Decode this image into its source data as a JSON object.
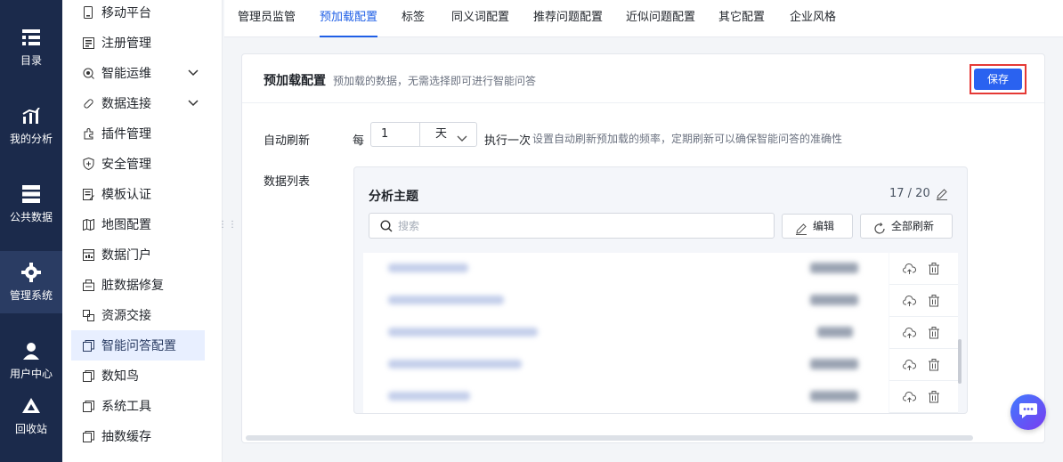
{
  "rail": {
    "items": [
      {
        "label": "目录",
        "icon": "list-icon"
      },
      {
        "label": "我的分析",
        "icon": "chart-icon"
      },
      {
        "label": "公共数据",
        "icon": "database-icon"
      },
      {
        "label": "管理系统",
        "icon": "gear-icon",
        "active": true
      },
      {
        "label": "用户中心",
        "icon": "user-icon"
      },
      {
        "label": "回收站",
        "icon": "recycle-icon"
      }
    ]
  },
  "submenu": {
    "items": [
      {
        "label": "移动平台",
        "icon": "mobile-icon"
      },
      {
        "label": "注册管理",
        "icon": "register-icon"
      },
      {
        "label": "智能运维",
        "icon": "ops-icon",
        "expandable": true
      },
      {
        "label": "数据连接",
        "icon": "link-icon",
        "expandable": true
      },
      {
        "label": "插件管理",
        "icon": "plugin-icon"
      },
      {
        "label": "安全管理",
        "icon": "shield-icon"
      },
      {
        "label": "模板认证",
        "icon": "template-icon"
      },
      {
        "label": "地图配置",
        "icon": "map-icon"
      },
      {
        "label": "数据门户",
        "icon": "portal-icon"
      },
      {
        "label": "脏数据修复",
        "icon": "repair-icon"
      },
      {
        "label": "资源交接",
        "icon": "handover-icon"
      },
      {
        "label": "智能问答配置",
        "icon": "copy-icon",
        "active": true
      },
      {
        "label": "数知鸟",
        "icon": "copy-icon"
      },
      {
        "label": "系统工具",
        "icon": "copy-icon"
      },
      {
        "label": "抽数缓存",
        "icon": "copy-icon"
      }
    ]
  },
  "tabs": [
    {
      "label": "管理员监管"
    },
    {
      "label": "预加载配置",
      "active": true
    },
    {
      "label": "标签"
    },
    {
      "label": "同义词配置"
    },
    {
      "label": "推荐问题配置"
    },
    {
      "label": "近似问题配置"
    },
    {
      "label": "其它配置"
    },
    {
      "label": "企业风格"
    }
  ],
  "card": {
    "title": "预加载配置",
    "description": "预加载的数据，无需选择即可进行智能问答",
    "save_label": "保存"
  },
  "refresh": {
    "label": "自动刷新",
    "every": "每",
    "value": "1",
    "unit": "天",
    "exec": "执行一次",
    "description": "设置自动刷新预加载的频率，定期刷新可以确保智能问答的准确性"
  },
  "datalist": {
    "label": "数据列表",
    "panel_title": "分析主题",
    "count": "17 / 20",
    "search_placeholder": "搜索",
    "edit_label": "编辑",
    "refresh_all_label": "全部刷新"
  },
  "colors": {
    "rail_bg": "#1b2a4b",
    "accent": "#1f5fe6",
    "save_bg": "#2a62f0",
    "highlight_border": "#e53935"
  }
}
